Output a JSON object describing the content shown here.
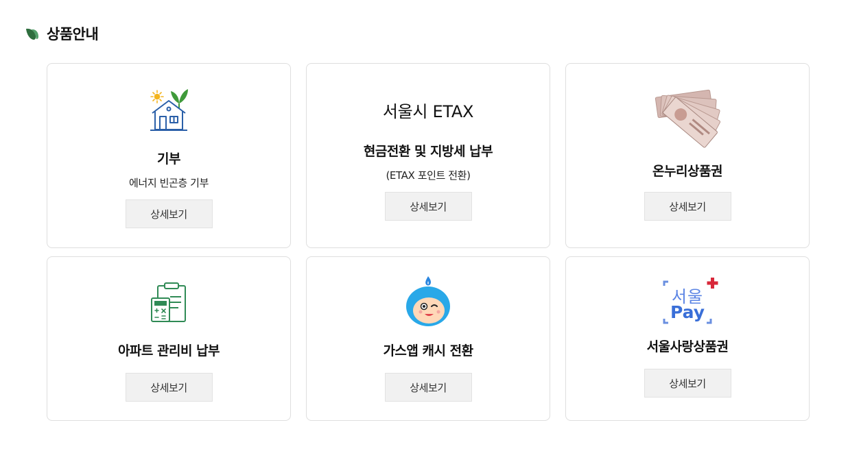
{
  "section": {
    "title": "상품안내"
  },
  "cards": [
    {
      "title": "기부",
      "subtitle": "에너지 빈곤층 기부",
      "button": "상세보기",
      "icon": "house-sprout-icon"
    },
    {
      "heading": "서울시 ETAX",
      "title": "현금전환 및 지방세 납부",
      "subtitle": "(ETAX 포인트 전환)",
      "button": "상세보기"
    },
    {
      "title": "온누리상품권",
      "button": "상세보기",
      "icon": "banknotes-icon"
    },
    {
      "title": "아파트 관리비 납부",
      "button": "상세보기",
      "icon": "calculator-clipboard-icon"
    },
    {
      "title": "가스앱 캐시 전환",
      "button": "상세보기",
      "icon": "gas-mascot-icon"
    },
    {
      "title": "서울사랑상품권",
      "button": "상세보기",
      "logo": {
        "line1": "서울",
        "line2": "Pay"
      }
    }
  ],
  "colors": {
    "leaf": "#2e6e3e",
    "house": "#2a5fa8",
    "sprout": "#3f9a3a",
    "mascot": "#29a8e8",
    "seoulpay_blue": "#3a6fd8",
    "seoulpay_red": "#d8283a"
  }
}
